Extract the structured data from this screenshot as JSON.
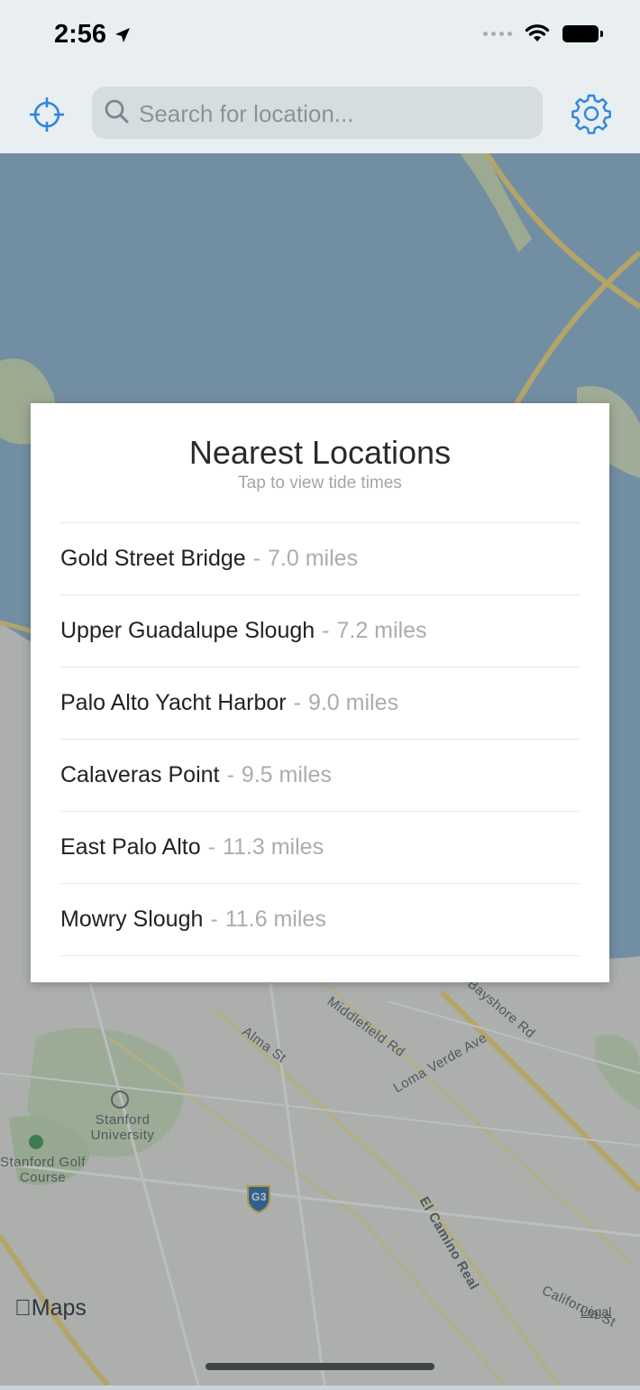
{
  "status_bar": {
    "time": "2:56"
  },
  "header": {
    "search": {
      "placeholder": "Search for location..."
    },
    "locate_icon": "crosshair-icon",
    "settings_icon": "gear-icon",
    "accent_color": "#2f86de"
  },
  "map": {
    "labels": [
      "Stanford University",
      "Stanford Golf Course",
      "Middlefield Rd",
      "Alma St",
      "Loma Verde Ave",
      "Bayshore Rd",
      "El Camino Real",
      "California St",
      "G3"
    ],
    "brand": "Maps",
    "legal": "Legal"
  },
  "card": {
    "title": "Nearest Locations",
    "subtitle": "Tap to view tide times",
    "separator": "-",
    "locations": [
      {
        "name": "Gold Street Bridge",
        "distance": "7.0 miles"
      },
      {
        "name": "Upper Guadalupe Slough",
        "distance": "7.2 miles"
      },
      {
        "name": "Palo Alto Yacht Harbor",
        "distance": "9.0 miles"
      },
      {
        "name": "Calaveras Point",
        "distance": "9.5 miles"
      },
      {
        "name": "East Palo Alto",
        "distance": "11.3 miles"
      },
      {
        "name": "Mowry Slough",
        "distance": "11.6 miles"
      }
    ]
  }
}
